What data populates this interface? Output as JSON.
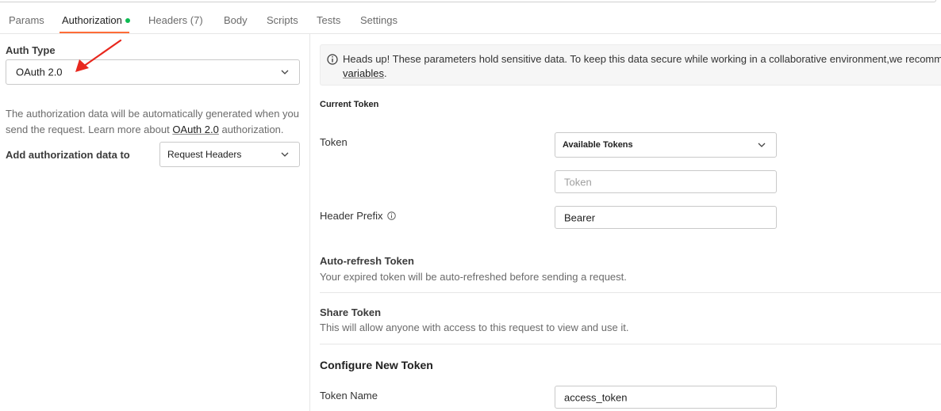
{
  "tabs": [
    {
      "label": "Params"
    },
    {
      "label": "Authorization",
      "active": true,
      "dot": true
    },
    {
      "label": "Headers",
      "count": "(7)"
    },
    {
      "label": "Body"
    },
    {
      "label": "Scripts"
    },
    {
      "label": "Tests"
    },
    {
      "label": "Settings"
    }
  ],
  "left": {
    "auth_type_label": "Auth Type",
    "auth_type_value": "OAuth 2.0",
    "description_part1": "The authorization data will be automatically generated when you",
    "description_part2": "send the request. Learn more about ",
    "description_link": "OAuth 2.0",
    "description_part3": " authorization.",
    "add_to_label": "Add authorization data to",
    "add_to_value": "Request Headers"
  },
  "banner": {
    "line1": "Heads up! These parameters hold sensitive data. To keep this data secure while working in a collaborative environment,we recommer",
    "link": "variables",
    "suffix": "."
  },
  "current_token": {
    "heading": "Current Token",
    "token_label": "Token",
    "available_tokens": "Available Tokens",
    "token_placeholder": "Token",
    "header_prefix_label": "Header Prefix",
    "header_prefix_value": "Bearer"
  },
  "auto_refresh": {
    "title": "Auto-refresh Token",
    "desc": "Your expired token will be auto-refreshed before sending a request."
  },
  "share": {
    "title": "Share Token",
    "desc": "This will allow anyone with access to this request to view and use it."
  },
  "configure": {
    "heading": "Configure New Token",
    "token_name_label": "Token Name",
    "token_name_value": "access_token"
  },
  "colors": {
    "accent": "#ff6c37",
    "status_dot": "#0cbb52",
    "annotation_arrow": "#e8281e"
  }
}
